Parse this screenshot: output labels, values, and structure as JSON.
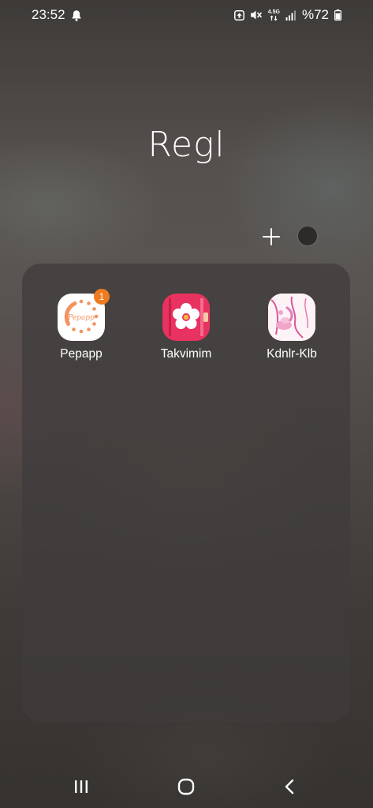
{
  "status_bar": {
    "time": "23:52",
    "network_type": "4.5G",
    "battery": "%72"
  },
  "folder": {
    "title": "Regl",
    "apps": [
      {
        "label": "Pepapp",
        "badge": "1",
        "icon": "pepapp-icon",
        "icon_text": "Pepapp"
      },
      {
        "label": "Takvimim",
        "badge": null,
        "icon": "takvimim-icon"
      },
      {
        "label": "Kdnlr-Klb",
        "badge": null,
        "icon": "kdnlr-klb-icon"
      }
    ]
  },
  "colors": {
    "badge": "#f07a1e",
    "pepapp_accent": "#f2935f",
    "takvimim_pink": "#e8325f",
    "folder_panel": "#3e3c3c"
  },
  "nav_bar": {
    "recents": "recents-icon",
    "home": "home-icon",
    "back": "back-icon"
  }
}
